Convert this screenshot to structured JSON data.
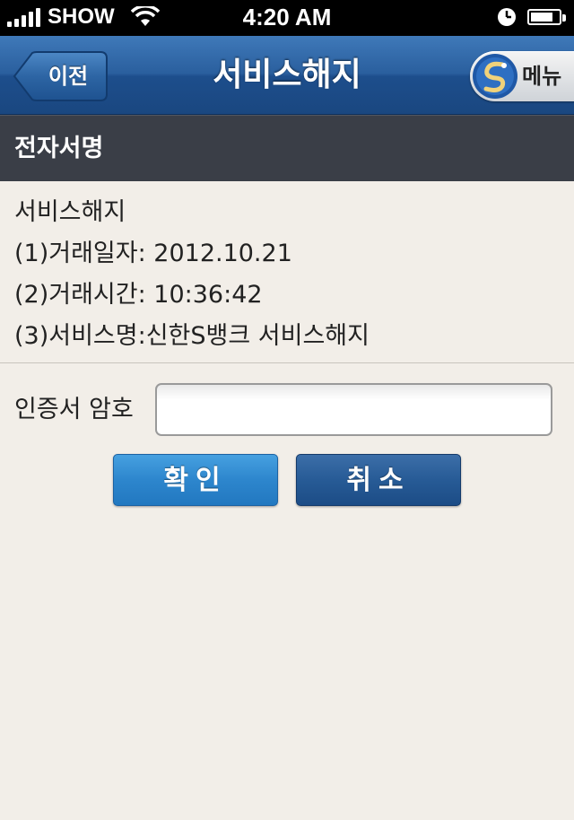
{
  "status_bar": {
    "carrier": "SHOW",
    "time": "4:20 AM"
  },
  "nav": {
    "back_label": "이전",
    "title": "서비스해지",
    "menu_label": "메뉴"
  },
  "section": {
    "title": "전자서명"
  },
  "info": {
    "lines": [
      "서비스해지",
      "(1)거래일자: 2012.10.21",
      "(2)거래시간: 10:36:42",
      "(3)서비스명:신한S뱅크 서비스해지"
    ]
  },
  "password": {
    "label": "인증서 암호",
    "value": "",
    "placeholder": ""
  },
  "buttons": {
    "confirm_label": "확인",
    "cancel_label": "취소"
  },
  "colors": {
    "nav_bar": "#2a5f9e",
    "section_header": "#3a3e47",
    "background": "#f2eee8",
    "confirm_button": "#2d86cd",
    "cancel_button": "#275b96"
  },
  "icons": {
    "signal": "signal-icon",
    "wifi": "wifi-icon",
    "lock": "orientation-lock-icon",
    "battery": "battery-icon",
    "back": "back-arrow-icon",
    "logo": "shinhan-logo-icon"
  }
}
